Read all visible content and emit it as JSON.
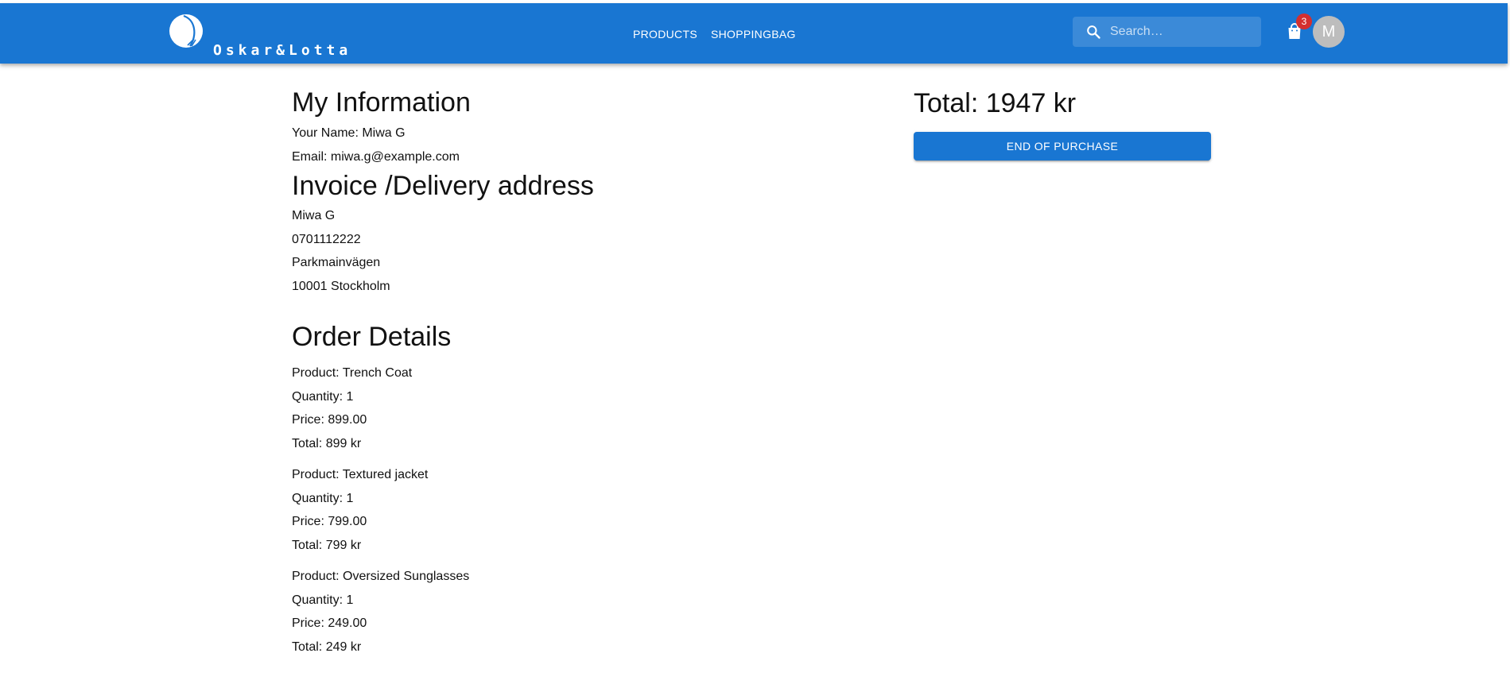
{
  "header": {
    "brand": "Oskar&Lotta",
    "nav": [
      {
        "label": "PRODUCTS"
      },
      {
        "label": "SHOPPINGBAG"
      }
    ],
    "search": {
      "placeholder": "Search…",
      "icon": "search-icon"
    },
    "cart": {
      "icon": "shopping-bag-icon",
      "count": "3"
    },
    "avatar": {
      "initial": "M"
    },
    "colors": {
      "appbar": "#1976d2",
      "badge": "#d32f2f",
      "avatar": "#bdbdbd"
    }
  },
  "my_information": {
    "title": "My Information",
    "name": "Your Name: Miwa G",
    "email": "Email: miwa.g@example.com"
  },
  "address": {
    "title": "Invoice /Delivery address",
    "lines": [
      "Miwa G",
      "0701112222",
      "Parkmainvägen",
      "10001 Stockholm"
    ]
  },
  "order": {
    "title": "Order Details",
    "items": [
      {
        "product": "Product: Trench Coat",
        "quantity": "Quantity: 1",
        "price": "Price: 899.00",
        "total": "Total: 899 kr"
      },
      {
        "product": "Product: Textured jacket",
        "quantity": "Quantity: 1",
        "price": "Price: 799.00",
        "total": "Total: 799 kr"
      },
      {
        "product": "Product: Oversized Sunglasses",
        "quantity": "Quantity: 1",
        "price": "Price: 249.00",
        "total": "Total: 249 kr"
      }
    ]
  },
  "summary": {
    "total": "Total: 1947 kr",
    "button_label": "END OF PURCHASE",
    "button_color": "#1976d2"
  }
}
